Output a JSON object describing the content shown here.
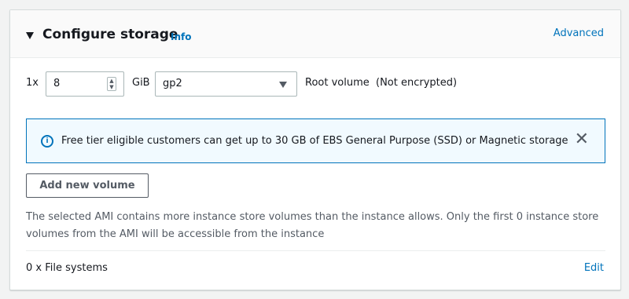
{
  "section": {
    "title": "Configure storage",
    "info_link": "Info",
    "advanced_link": "Advanced"
  },
  "volume": {
    "count": "1x",
    "size": "8",
    "unit": "GiB",
    "type": "gp2",
    "label": "Root volume  (Not encrypted)"
  },
  "alert": {
    "message": "Free tier eligible customers can get up to 30 GB of EBS General Purpose (SSD) or Magnetic storage",
    "close": "✕",
    "icon": "info-icon"
  },
  "add_volume_button": "Add new volume",
  "note": "The selected AMI contains more instance store volumes than the instance allows. Only the first 0 instance store volumes from the AMI will be accessible from the instance",
  "file_systems": {
    "label": "0 x File systems",
    "edit_link": "Edit"
  },
  "colors": {
    "link": "#0073bb",
    "alert_bg": "#f1faff",
    "border": "#aab7b8"
  }
}
